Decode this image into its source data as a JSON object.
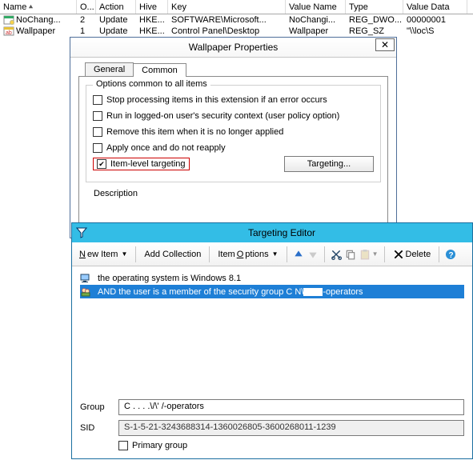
{
  "grid": {
    "columns": [
      "Name",
      "O...",
      "Action",
      "Hive",
      "Key",
      "Value Name",
      "Type",
      "Value Data"
    ],
    "rows": [
      {
        "name": "NoChang...",
        "order": "2",
        "action": "Update",
        "hive": "HKE...",
        "key": "SOFTWARE\\Microsoft...",
        "valueName": "NoChangi...",
        "type": "REG_DWO...",
        "valueData": "00000001"
      },
      {
        "name": "Wallpaper",
        "order": "1",
        "action": "Update",
        "hive": "HKE...",
        "key": "Control Panel\\Desktop",
        "valueName": "Wallpaper",
        "type": "REG_SZ",
        "valueData": "\"\\\\loc\\S"
      }
    ]
  },
  "props": {
    "title": "Wallpaper Properties",
    "tabs": {
      "general": "General",
      "common": "Common"
    },
    "group_legend": "Options common to all items",
    "opts": {
      "stop": "Stop processing items in this extension if an error occurs",
      "ctx": "Run in logged-on user's security context (user policy option)",
      "remove": "Remove this item when it is no longer applied",
      "once": "Apply once and do not reapply",
      "ilt": "Item-level targeting"
    },
    "targeting_btn": "Targeting...",
    "description_label": "Description"
  },
  "te": {
    "title": "Targeting Editor",
    "toolbar": {
      "new_item": "New Item",
      "add_collection": "Add Collection",
      "item_options": "Item Options",
      "delete": "Delete"
    },
    "rules": {
      "os": "the operating system is Windows 8.1",
      "and_prefix": "AND ",
      "member_prefix": "the user is a member of the security group ",
      "group_redacted_mid": "C      N\\",
      "group_suffix": "-operators"
    },
    "fields": {
      "group_label": "Group",
      "sid_label": "SID",
      "group_value": "C . . . .\\/\\'    /-operators",
      "sid_value": "S-1-5-21-3243688314-1360026805-3600268011-1239",
      "primary": "Primary group"
    }
  }
}
